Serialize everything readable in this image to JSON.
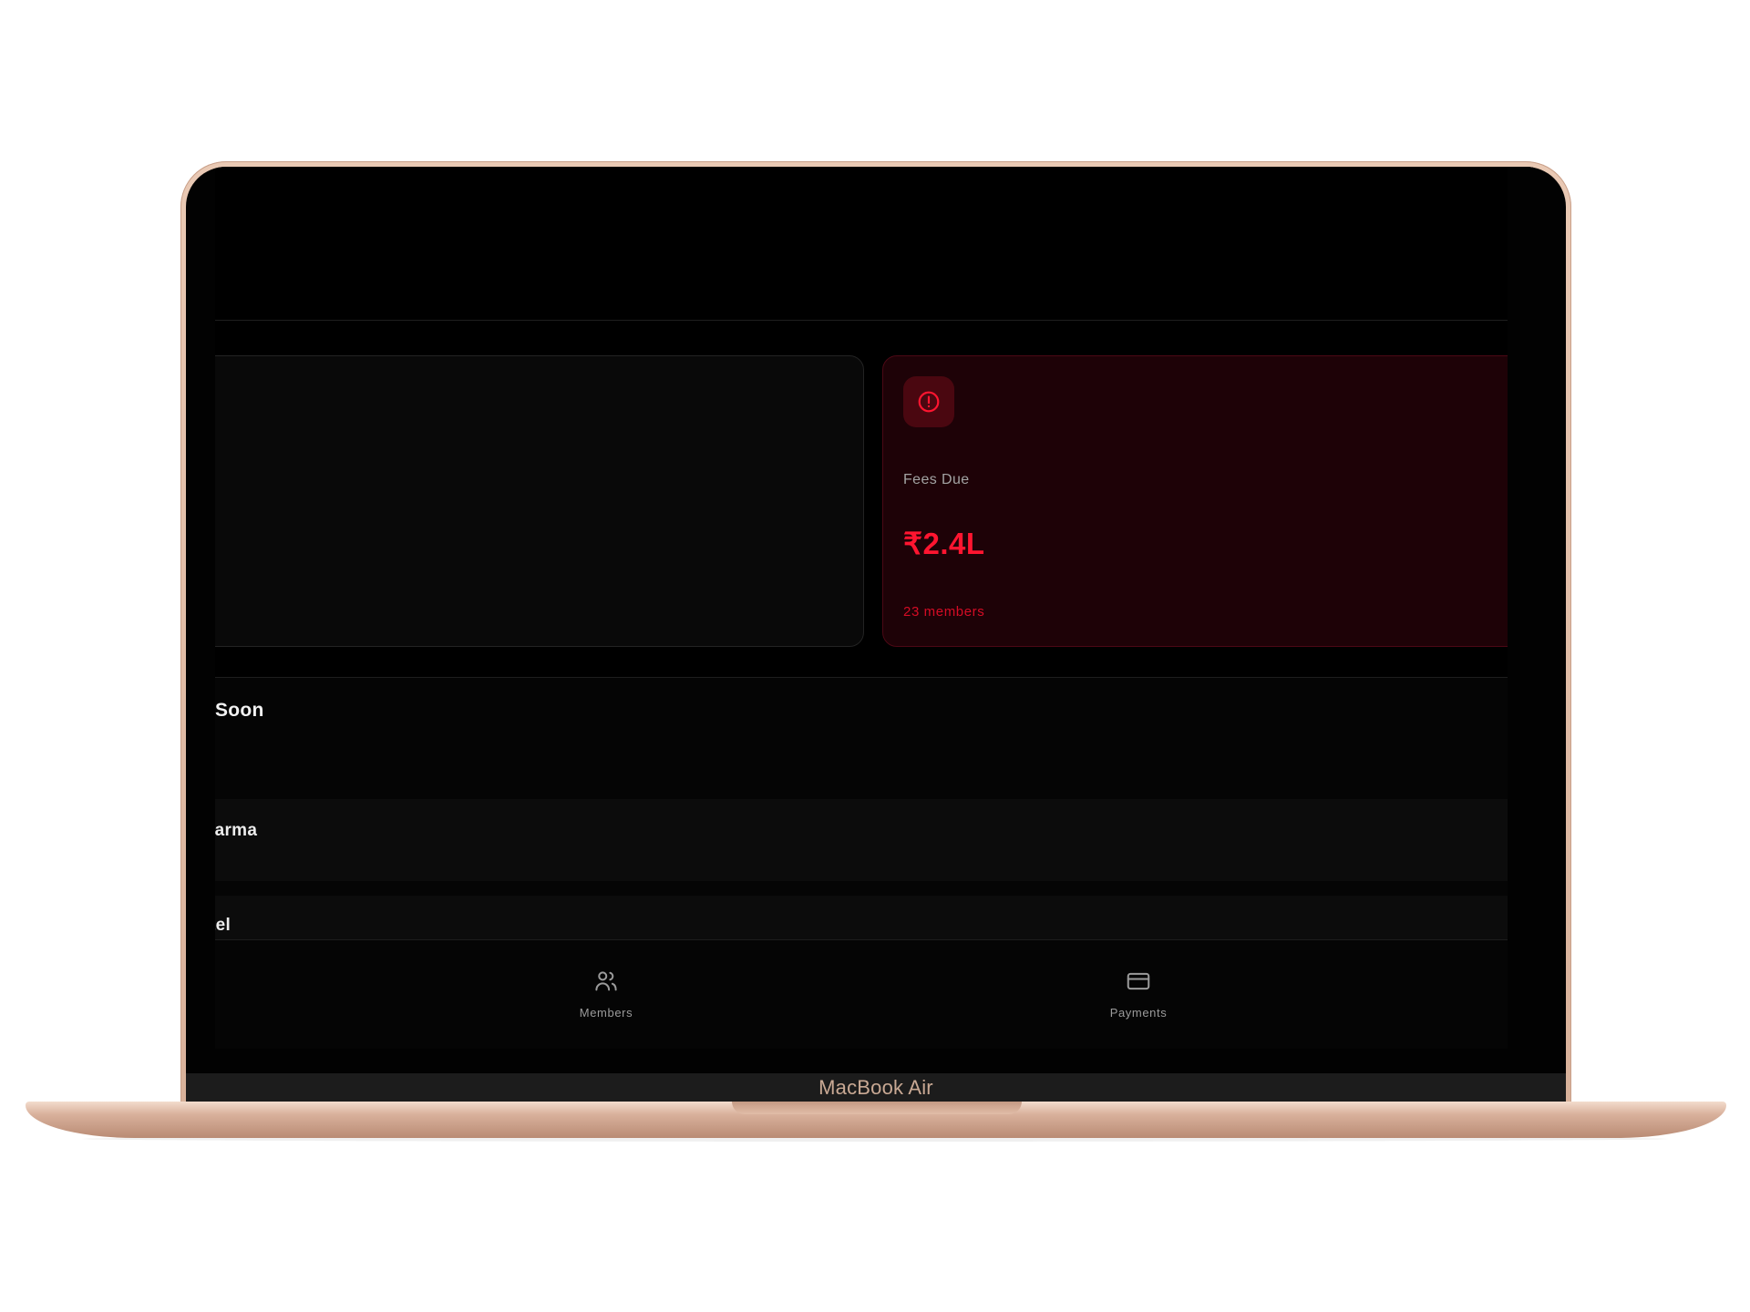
{
  "device": {
    "label": "MacBook Air"
  },
  "dashboard": {
    "fees_card": {
      "icon": "alert-circle-icon",
      "label": "Fees Due",
      "amount": "₹2.4L",
      "subtext": "23 members",
      "accent_color": "#ff1530"
    },
    "section": {
      "title": "Soon"
    },
    "list": {
      "rows": [
        {
          "name": "ıarma"
        },
        {
          "name": "tel"
        }
      ]
    },
    "bottom_nav": {
      "items": [
        {
          "label": "Members",
          "icon": "users-icon"
        },
        {
          "label": "Payments",
          "icon": "credit-card-icon"
        }
      ]
    }
  }
}
